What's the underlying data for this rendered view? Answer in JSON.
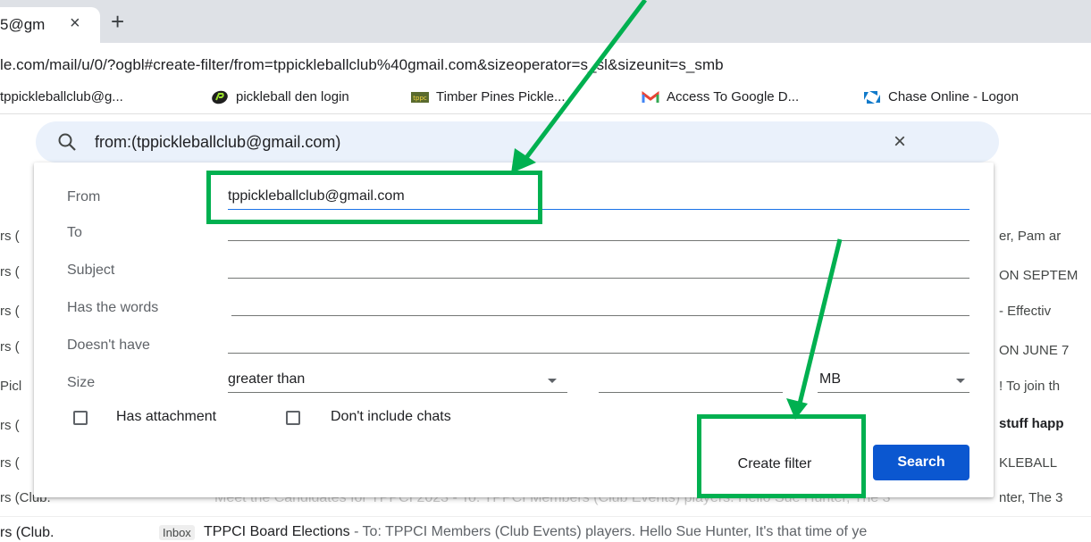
{
  "browser": {
    "tab_title": "5@gm",
    "tab_close": "×",
    "new_tab": "+",
    "url": "le.com/mail/u/0/?ogbl#create-filter/from=tppickleballclub%40gmail.com&sizeoperator=s_sl&sizeunit=s_smb",
    "bookmarks": [
      {
        "label": "tppickleballclub@g...",
        "icon": "none"
      },
      {
        "label": "pickleball den login",
        "icon": "pickleball-den-icon"
      },
      {
        "label": "Timber Pines Pickle...",
        "icon": "tppc-icon"
      },
      {
        "label": "Access To Google D...",
        "icon": "gmail-icon"
      },
      {
        "label": "Chase Online - Logon",
        "icon": "chase-icon"
      }
    ]
  },
  "search": {
    "query": "from:(tppickleballclub@gmail.com)",
    "close": "×"
  },
  "filter_dialog": {
    "from_label": "From",
    "from_value": "tppickleballclub@gmail.com",
    "to_label": "To",
    "subject_label": "Subject",
    "has_words_label": "Has the words",
    "doesnt_have_label": "Doesn't have",
    "size_label": "Size",
    "size_operator": "greater than",
    "size_value": "",
    "size_unit": "MB",
    "has_attachment_label": "Has attachment",
    "no_chats_label": "Don't include chats",
    "create_filter_label": "Create filter",
    "search_label": "Search"
  },
  "background_list": {
    "left_fragments": [
      "rs (",
      "rs (",
      "rs (",
      "rs (",
      "Picl",
      "rs (",
      "rs (",
      "rs (Club."
    ],
    "right_fragments": [
      "er, Pam ar",
      "ON SEPTEM",
      " - Effectiv",
      "ON JUNE 7",
      "! To join th",
      "stuff happ",
      "KLEBALL",
      "nter, The 3"
    ],
    "faded_row": "Meet the Candidates for TPPCI 2023 - To: TPPCI Members (Club Events) players. Hello Sue Hunter, The 3",
    "last_row": {
      "sender": "rs (Club.",
      "badge": "Inbox",
      "subject": "TPPCI Board Elections",
      "snippet": " - To: TPPCI Members (Club Events) players. Hello Sue Hunter, It's that time of ye"
    }
  },
  "colors": {
    "annotation": "#00b050",
    "search_button": "#0b57d0",
    "search_bar_bg": "#eaf1fb"
  }
}
